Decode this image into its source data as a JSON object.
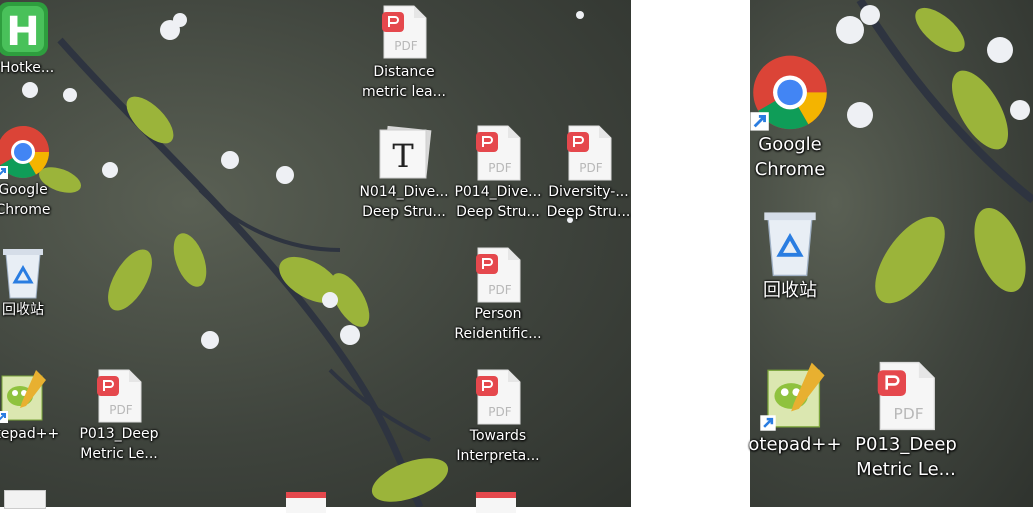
{
  "left_panel": {
    "icons": [
      {
        "id": "hotkey",
        "label": "yHotke...",
        "icon": "hotkey-app-icon"
      },
      {
        "id": "chrome",
        "label": "Google\nChrome",
        "icon": "chrome-icon"
      },
      {
        "id": "recycle",
        "label": "回收站",
        "icon": "recycle-bin-icon"
      },
      {
        "id": "notepad",
        "label": "otepad++",
        "icon": "notepad-plus-plus-icon"
      },
      {
        "id": "p013",
        "label": "P013_Deep\nMetric Le...",
        "icon": "pdf-icon"
      },
      {
        "id": "distance",
        "label": "Distance\nmetric lea...",
        "icon": "pdf-icon"
      },
      {
        "id": "n014",
        "label": "N014_Dive...\nDeep Stru...",
        "icon": "typora-t-icon"
      },
      {
        "id": "p014",
        "label": "P014_Dive...\nDeep Stru...",
        "icon": "pdf-icon"
      },
      {
        "id": "diversity",
        "label": "Diversity-...\nDeep Stru...",
        "icon": "pdf-icon"
      },
      {
        "id": "person",
        "label": "Person\nReidentific...",
        "icon": "pdf-icon"
      },
      {
        "id": "towards",
        "label": "Towards\nInterpreta...",
        "icon": "pdf-icon"
      }
    ]
  },
  "right_panel": {
    "icons": [
      {
        "id": "chrome_zoom",
        "label": "Google\nChrome",
        "icon": "chrome-icon"
      },
      {
        "id": "recycle_zoom",
        "label": "回收站",
        "icon": "recycle-bin-icon"
      },
      {
        "id": "notepad_zoom",
        "label": "otepad++",
        "icon": "notepad-plus-plus-icon"
      },
      {
        "id": "p013_zoom",
        "label": "P013_Deep\nMetric Le...",
        "icon": "pdf-icon"
      }
    ]
  },
  "pdf_badge_text": "PDF",
  "hotkey_letter": "H",
  "typora_letter": "T",
  "colors": {
    "pdf_red": "#e5484d",
    "chrome_red": "#db4437",
    "chrome_yellow": "#f4b400",
    "chrome_green": "#0f9d58",
    "chrome_blue": "#4285f4",
    "hotkey_green": "#2e9e3e",
    "recycle_blue": "#2a7de1"
  }
}
